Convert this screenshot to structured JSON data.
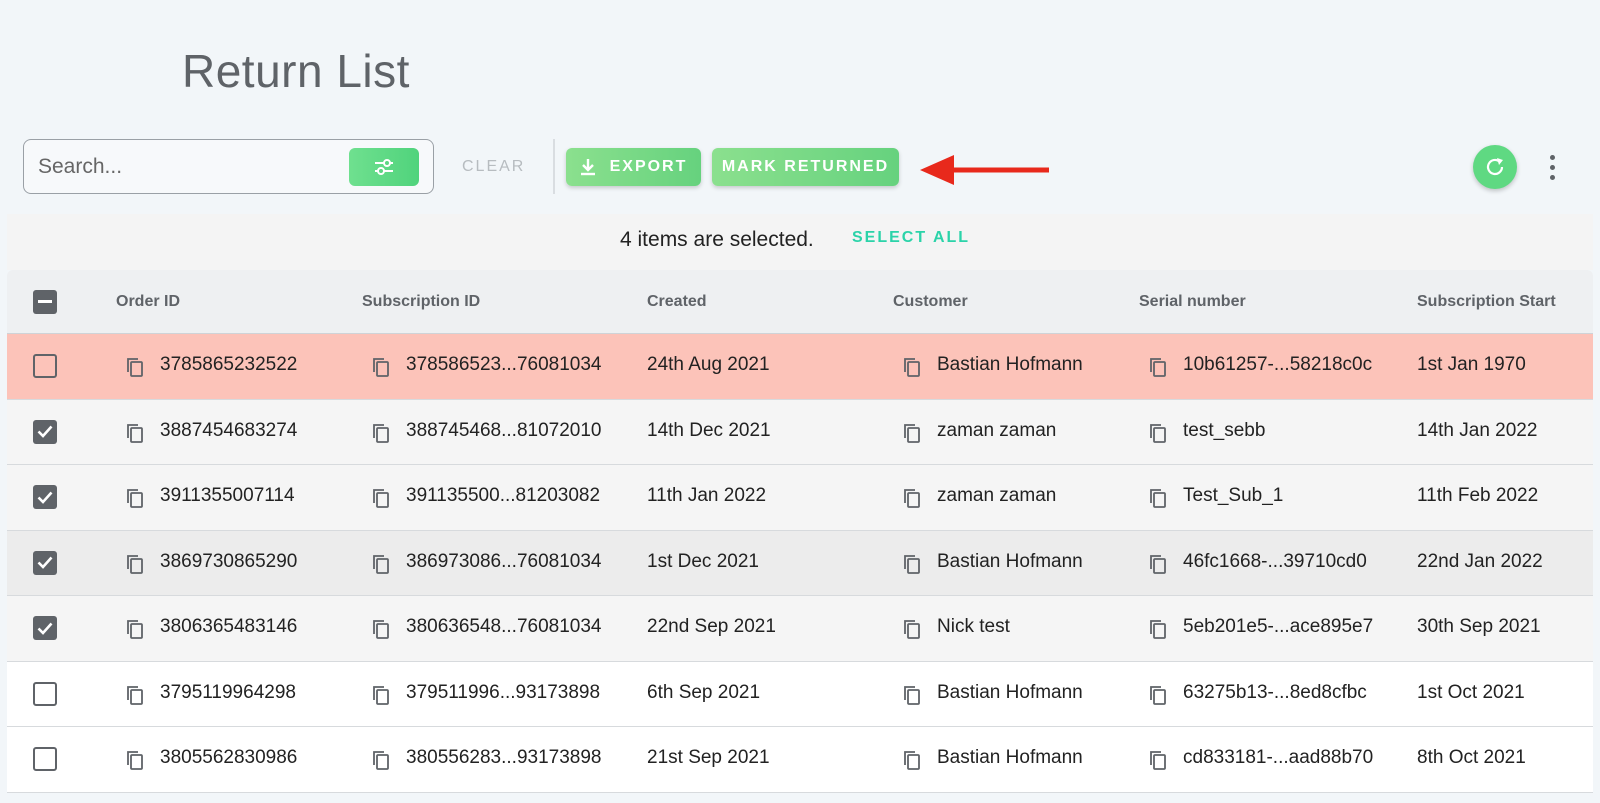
{
  "page": {
    "title": "Return List"
  },
  "toolbar": {
    "search_placeholder": "Search...",
    "clear_label": "CLEAR",
    "export_label": "EXPORT",
    "mark_returned_label": "MARK RETURNED"
  },
  "selection": {
    "text": "4 items are selected.",
    "select_all_label": "SELECT ALL"
  },
  "table": {
    "columns": [
      "Order ID",
      "Subscription ID",
      "Created",
      "Customer",
      "Serial number",
      "Subscription Start"
    ],
    "rows": [
      {
        "order_id": "3785865232522",
        "subscription_id": "378586523...76081034",
        "created": "24th Aug 2021",
        "customer": "Bastian Hofmann",
        "serial": "10b61257-...58218c0c",
        "start": "1st Jan 1970",
        "checked": false,
        "state": "flagged"
      },
      {
        "order_id": "3887454683274",
        "subscription_id": "388745468...81072010",
        "created": "14th Dec 2021",
        "customer": "zaman zaman",
        "serial": "test_sebb",
        "start": "14th Jan 2022",
        "checked": true,
        "state": "selected"
      },
      {
        "order_id": "3911355007114",
        "subscription_id": "391135500...81203082",
        "created": "11th Jan 2022",
        "customer": "zaman zaman",
        "serial": "Test_Sub_1",
        "start": "11th Feb 2022",
        "checked": true,
        "state": "selected"
      },
      {
        "order_id": "3869730865290",
        "subscription_id": "386973086...76081034",
        "created": "1st Dec 2021",
        "customer": "Bastian Hofmann",
        "serial": "46fc1668-...39710cd0",
        "start": "22nd Jan 2022",
        "checked": true,
        "state": "hover"
      },
      {
        "order_id": "3806365483146",
        "subscription_id": "380636548...76081034",
        "created": "22nd Sep 2021",
        "customer": "Nick test",
        "serial": "5eb201e5-...ace895e7",
        "start": "30th Sep 2021",
        "checked": true,
        "state": "selected"
      },
      {
        "order_id": "3795119964298",
        "subscription_id": "379511996...93173898",
        "created": "6th Sep 2021",
        "customer": "Bastian Hofmann",
        "serial": "63275b13-...8ed8cfbc",
        "start": "1st Oct 2021",
        "checked": false,
        "state": "normal"
      },
      {
        "order_id": "3805562830986",
        "subscription_id": "380556283...93173898",
        "created": "21st Sep 2021",
        "customer": "Bastian Hofmann",
        "serial": "cd833181-...aad88b70",
        "start": "8th Oct 2021",
        "checked": false,
        "state": "normal"
      }
    ]
  },
  "colors": {
    "accent_green": "#5fd982",
    "select_all_teal": "#2bd3a9",
    "flagged_row": "#fcc3b9",
    "annotation_arrow": "#e8291c"
  },
  "icons": {
    "filter": "sliders-icon",
    "export": "download-icon",
    "refresh": "refresh-icon",
    "more": "more-vert-icon",
    "copy": "copy-icon",
    "annotation": "arrow-left-icon"
  }
}
